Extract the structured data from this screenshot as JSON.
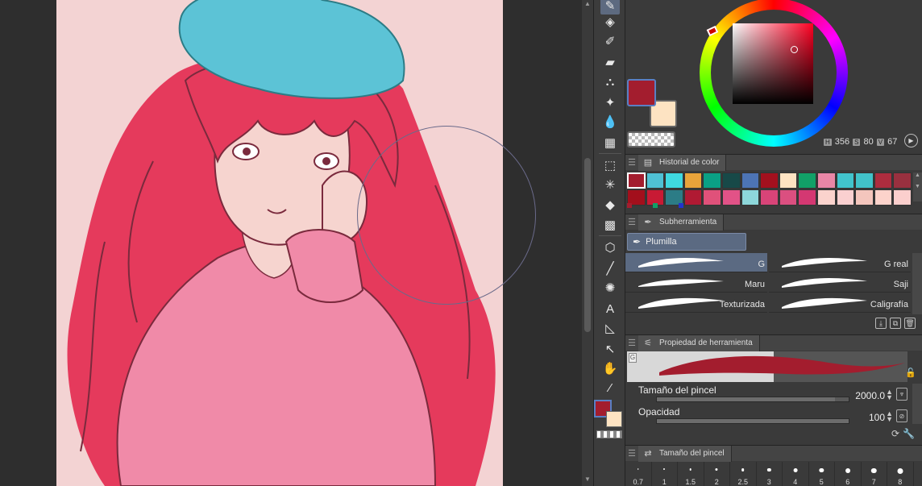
{
  "color_wheel": {
    "main_color": "#a31d2e",
    "sub_color": "#fde3c2",
    "hue": "356",
    "saturation": "80",
    "value": "67",
    "s_label": "S",
    "v_label": "V"
  },
  "color_history": {
    "title": "Historial de color",
    "swatches": [
      "#a31d2e",
      "#4fc1d4",
      "#3fd9e0",
      "#e9a43a",
      "#0aa085",
      "#174948",
      "#4d74b5",
      "#a3101e",
      "#fde3c2",
      "#11a067",
      "#e986a6",
      "#41c3cc",
      "#41c2c9",
      "#ad2c3e",
      "#99303f",
      "#a30f1c",
      "#c81a34",
      "#2c7c86",
      "#b01a33",
      "#e0517a",
      "#e25287",
      "#8dd7da",
      "#d84478",
      "#db4f80",
      "#d43872",
      "#fbd3cd",
      "#fad0d0",
      "#f4c6bd",
      "#fcd3cb",
      "#fbcfcd"
    ],
    "mini_dots": [
      "#a31d2e",
      "#11a067",
      "#2233cc"
    ]
  },
  "subtool": {
    "title": "Subherramienta",
    "group": "Plumilla",
    "brushes": [
      "G",
      "G real",
      "Maru",
      "Saji",
      "Texturizada",
      "Caligrafía"
    ]
  },
  "tool_property": {
    "title": "Propiedad de herramienta",
    "preview_tag": "G",
    "brush_size_label": "Tamaño del pincel",
    "brush_size_value": "2000.0",
    "brush_size_fraction": 0.93,
    "opacity_label": "Opacidad",
    "opacity_value": "100",
    "opacity_fraction": 1.0
  },
  "brush_size_palette": {
    "title": "Tamaño del pincel",
    "sizes": [
      "0.7",
      "1",
      "1.5",
      "2",
      "2.5",
      "3",
      "4",
      "5",
      "6",
      "7",
      "8"
    ]
  },
  "tools": [
    "pen-icon",
    "airbrush-icon",
    "marker-icon",
    "eraser-icon",
    "blend-icon",
    "sparkle-icon",
    "water-drop-icon",
    "grid-icon",
    "lasso-icon",
    "magic-wand-icon",
    "bucket-icon",
    "gradient-icon",
    "cube-icon",
    "line-icon",
    "burst-icon",
    "text-icon",
    "operation-icon",
    "move-icon",
    "hand-icon",
    "eyedropper-icon"
  ]
}
